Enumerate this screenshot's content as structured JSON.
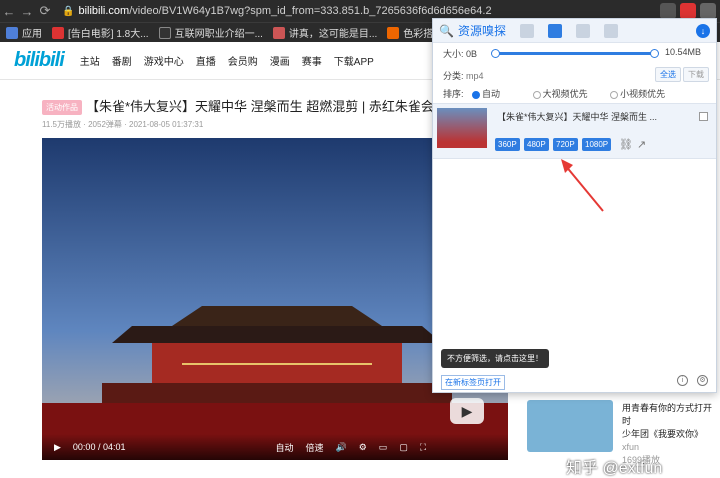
{
  "browser": {
    "url_domain": "bilibili.com",
    "url_path": "/video/BV1W64y1B7wg?spm_id_from=333.851.b_7265636f6d6d656e64.2",
    "bookmarks": [
      {
        "label": "应用",
        "color": "#4f7fd8"
      },
      {
        "label": "[告白电影] 1.8大...",
        "color": "#d33"
      },
      {
        "label": "互联网职业介绍一...",
        "color": "#333"
      },
      {
        "label": "讲真，这可能是目...",
        "color": "#c55"
      },
      {
        "label": "色彩搭配-最受欢迎...",
        "color": "#e60"
      }
    ]
  },
  "site": {
    "logo": "bilibili",
    "nav": [
      "主站",
      "番剧",
      "游戏中心",
      "直播",
      "会员购",
      "漫画",
      "赛事",
      "下载APP"
    ]
  },
  "video": {
    "tag": "活动作品",
    "title": "【朱雀*伟大复兴】天耀中华 涅槃而生 超燃混剪 | 赤红朱雀会飞过 此生",
    "plays": "11.5万播放",
    "danmaku": "2052弹幕",
    "date": "2021-08-05 01:37:31",
    "time": "00:00 / 04:01",
    "auto": "自动",
    "speed": "倍速"
  },
  "sidebar_rec": {
    "line1": "用青春有你的方式打开时",
    "line2": "少年团《我要欢你》",
    "line3": "xfun",
    "line4": "1699播放"
  },
  "panel": {
    "title": "资源嗅探",
    "size_label": "大小: 0B",
    "size_max": "10.54MB",
    "category_label": "分类:",
    "category_value": "mp4",
    "select_all": "全选",
    "download": "下载",
    "sort_label": "排序:",
    "sort_options": [
      "自动",
      "大视频优先",
      "小视频优先"
    ],
    "item_title": "【朱雀*伟大复兴】天耀中华 涅槃而生 ...",
    "qualities": [
      "360P",
      "480P",
      "720P",
      "1080P"
    ],
    "tooltip": "不方便筛选，请点击这里！",
    "new_tab": "在新标签页打开"
  },
  "watermark": "知乎 @extfun",
  "colors": {
    "accent": "#1a73e8",
    "bili": "#00a1d6",
    "arrow": "#e53935"
  }
}
